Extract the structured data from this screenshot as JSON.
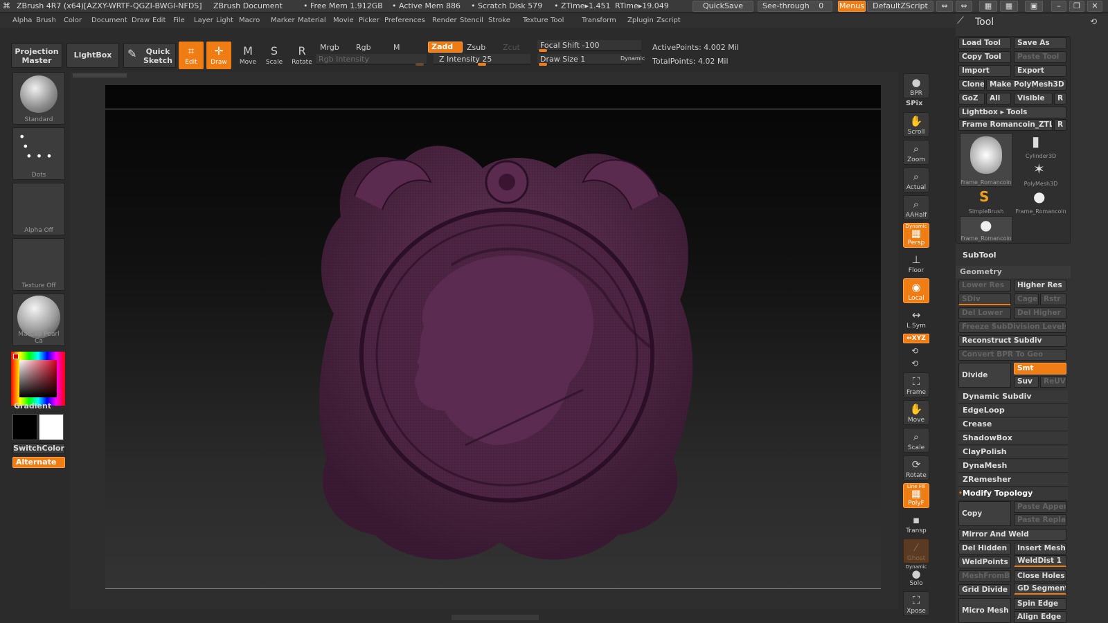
{
  "titlebar": {
    "app": "ZBrush 4R7 (x64)[AZXY-WRTF-QGZI-BWGI-NFDS]",
    "doc": "ZBrush Document",
    "free_mem": "• Free Mem 1.912GB",
    "active_mem": "• Active Mem 886",
    "scratch": "• Scratch Disk 579",
    "ztime": "• ZTime▸1.451",
    "rtime": "RTime▸19.049",
    "quicksave": "QuickSave",
    "seethrough": "See-through",
    "seethrough_val": "0",
    "menus": "Menus",
    "script": "DefaultZScript"
  },
  "menubar": [
    "Alpha",
    "Brush",
    "Color",
    "Document",
    "Draw",
    "Edit",
    "File",
    "Layer",
    "Light",
    "Macro",
    "Marker",
    "Material",
    "Movie",
    "Picker",
    "Preferences",
    "Render",
    "Stencil",
    "Stroke",
    "Texture",
    "Tool",
    "Transform",
    "Zplugin",
    "Zscript"
  ],
  "toolbar": {
    "projection_master": "Projection Master",
    "lightbox": "LightBox",
    "quick_sketch": "Quick Sketch",
    "edit": "Edit",
    "draw": "Draw",
    "move": "Move",
    "scale": "Scale",
    "rotate": "Rotate",
    "mrgb": "Mrgb",
    "rgb": "Rgb",
    "m": "M",
    "rgb_intensity": "Rgb Intensity",
    "zadd": "Zadd",
    "zsub": "Zsub",
    "zcut": "Zcut",
    "z_intensity": "Z Intensity 25",
    "focal_shift": "Focal Shift -100",
    "draw_size": "Draw Size 1",
    "dynamic": "Dynamic",
    "active_points": "ActivePoints: 4.002 Mil",
    "total_points": "TotalPoints: 4.02 Mil"
  },
  "leftshelf": {
    "brush": "Standard",
    "stroke": "Dots",
    "alpha": "Alpha Off",
    "texture": "Texture Off",
    "material": "MatCap Pearl Ca",
    "gradient": "Gradient",
    "switchcolor": "SwitchColor",
    "alternate": "Alternate"
  },
  "rightshelf": {
    "bpr": "BPR",
    "spix": "SPix",
    "scroll": "Scroll",
    "zoom": "Zoom",
    "actual": "Actual",
    "aahalf": "AAHalf",
    "dynamic": "Dynamic",
    "persp": "Persp",
    "floor": "Floor",
    "local": "Local",
    "lsym": "L.Sym",
    "xyz": "↔XYZ",
    "frame": "Frame",
    "move": "Move",
    "scale": "Scale",
    "rotate": "Rotate",
    "line_fill": "Line Fill",
    "polyf": "PolyF",
    "transp": "Transp",
    "ghost": "Ghost",
    "dynamic2": "Dynamic",
    "solo": "Solo",
    "xpose": "Xpose"
  },
  "toolpanel": {
    "title": "Tool",
    "load_tool": "Load Tool",
    "save_as": "Save As",
    "copy_tool": "Copy Tool",
    "paste_tool": "Paste Tool",
    "import": "Import",
    "export": "Export",
    "clone": "Clone",
    "make_polymesh": "Make PolyMesh3D",
    "goz": "GoZ",
    "all": "All",
    "visible": "Visible",
    "r": "R",
    "lightbox_tools": "Lightbox ▸ Tools",
    "current_tool": "Frame Romancoin_ZTL",
    "tools": [
      "Frame_Romancoin",
      "Cylinder3D",
      "PolyMesh3D",
      "SimpleBrush",
      "Frame_Romancoin",
      "Frame_Romancoin"
    ],
    "subtool": "SubTool",
    "geometry": "Geometry",
    "lower_res": "Lower Res",
    "higher_res": "Higher Res",
    "sdiv": "SDiv",
    "cage": "Cage",
    "rstr": "Rstr",
    "del_lower": "Del Lower",
    "del_higher": "Del Higher",
    "freeze": "Freeze SubDivision Levels",
    "reconstruct": "Reconstruct Subdiv",
    "convert_bpr": "Convert BPR To Geo",
    "divide": "Divide",
    "smt": "Smt",
    "suv": "Suv",
    "reuv": "ReUV",
    "sub_items": [
      "Dynamic Subdiv",
      "EdgeLoop",
      "Crease",
      "ShadowBox",
      "ClayPolish",
      "DynaMesh",
      "ZRemesher"
    ],
    "modify_topology": "Modify Topology",
    "copy": "Copy",
    "paste_append": "Paste Append",
    "paste_replace": "Paste Replac",
    "mirror_weld": "Mirror And Weld",
    "del_hidden": "Del Hidden",
    "insert_mesh": "Insert Mesh",
    "weldpoints": "WeldPoints",
    "welddist": "WeldDist 1",
    "meshfrombrush": "MeshFromBrush",
    "close_holes": "Close Holes",
    "grid_divide": "Grid Divide",
    "gd_segments": "GD Segments",
    "spin_edge": "Spin Edge",
    "micro_mesh": "Micro Mesh",
    "align_edge": "Align Edge"
  },
  "colors": {
    "accent": "#f07d14",
    "model": "#4a2540"
  }
}
